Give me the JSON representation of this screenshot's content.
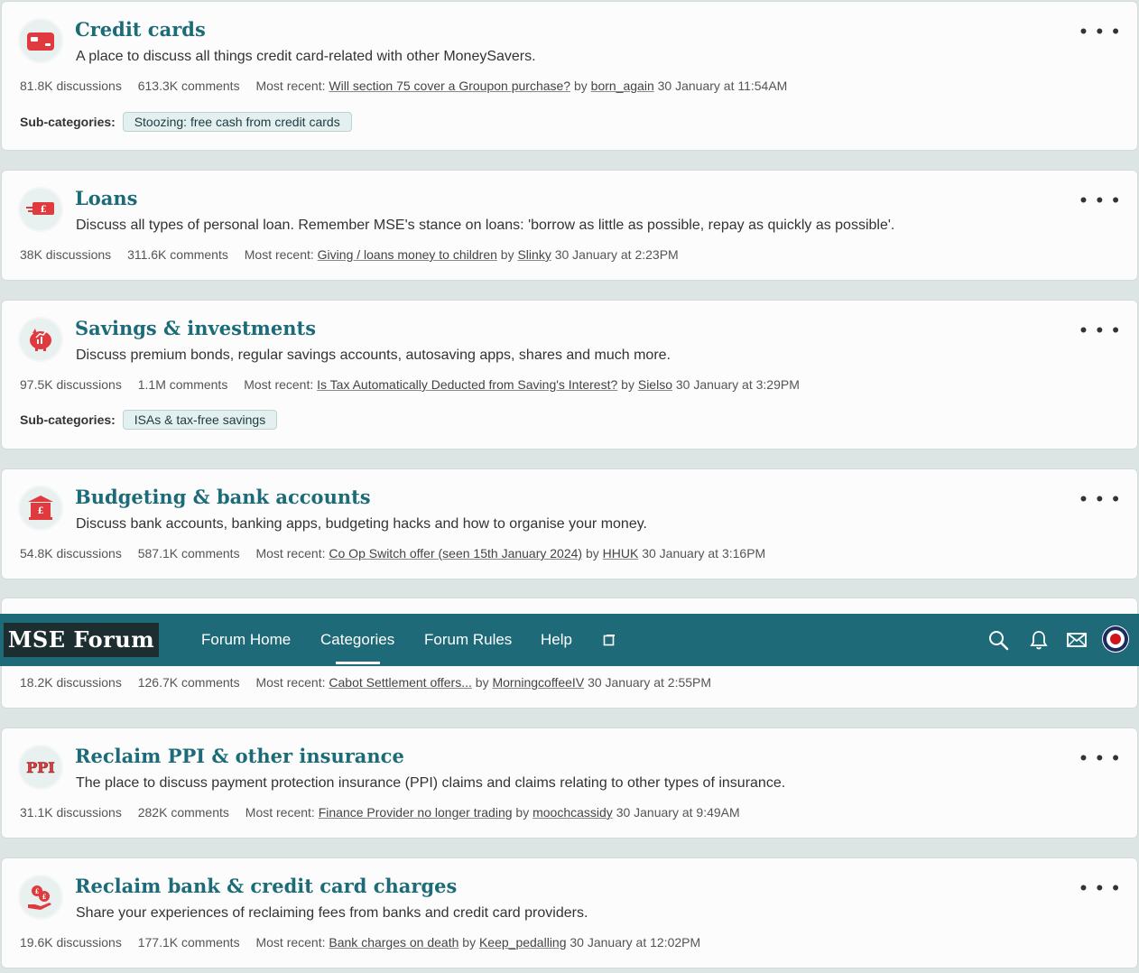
{
  "nav": {
    "logo": "MSE Forum",
    "items": [
      "Forum Home",
      "Categories",
      "Forum Rules",
      "Help"
    ],
    "active": "Categories"
  },
  "categories": [
    {
      "title": "Credit cards",
      "description": "A place to discuss all things credit card-related with other MoneySavers.",
      "discussions": "81.8K discussions",
      "comments": "613.3K comments",
      "most_recent_label": "Most recent:",
      "recent_title": "Will section 75 cover a Groupon purchase?",
      "by": "by",
      "author": "born_again",
      "date": "30 January at 11:54AM",
      "subcategories_label": "Sub-categories:",
      "subcategory": "Stoozing: free cash from credit cards"
    },
    {
      "title": "Loans",
      "description": "Discuss all types of personal loan. Remember MSE's stance on loans: 'borrow as little as possible, repay as quickly as possible'.",
      "discussions": "38K discussions",
      "comments": "311.6K comments",
      "most_recent_label": "Most recent:",
      "recent_title": "Giving / loans money to children",
      "by": "by",
      "author": "Slinky",
      "date": "30 January at 2:23PM"
    },
    {
      "title": "Savings & investments",
      "description": "Discuss premium bonds, regular savings accounts, autosaving apps, shares and much more.",
      "discussions": "97.5K discussions",
      "comments": "1.1M comments",
      "most_recent_label": "Most recent:",
      "recent_title": "Is Tax Automatically Deducted from Saving's Interest?",
      "by": "by",
      "author": "Sielso",
      "date": "30 January at 3:29PM",
      "subcategories_label": "Sub-categories:",
      "subcategory": "ISAs & tax-free savings"
    },
    {
      "title": "Budgeting & bank accounts",
      "description": "Discuss bank accounts, banking apps, budgeting hacks and how to organise your money.",
      "discussions": "54.8K discussions",
      "comments": "587.1K comments",
      "most_recent_label": "Most recent:",
      "recent_title": "Co Op Switch offer (seen 15th January 2024)",
      "by": "by",
      "author": "HHUK",
      "date": "30 January at 3:16PM"
    },
    {
      "discussions": "18.2K discussions",
      "comments": "126.7K comments",
      "most_recent_label": "Most recent:",
      "recent_title": "Cabot Settlement offers...",
      "by": "by",
      "author": "MorningcoffeeIV",
      "date": "30 January at 2:55PM"
    },
    {
      "title": "Reclaim PPI & other insurance",
      "icon_text": "PPI",
      "description": "The place to discuss payment protection insurance (PPI) claims and claims relating to other types of insurance.",
      "discussions": "31.1K discussions",
      "comments": "282K comments",
      "most_recent_label": "Most recent:",
      "recent_title": "Finance Provider no longer trading",
      "by": "by",
      "author": "moochcassidy",
      "date": "30 January at 9:49AM"
    },
    {
      "title": "Reclaim bank & credit card charges",
      "description": "Share your experiences of reclaiming fees from banks and credit card providers.",
      "discussions": "19.6K discussions",
      "comments": "177.1K comments",
      "most_recent_label": "Most recent:",
      "recent_title": "Bank charges on death",
      "by": "by",
      "author": "Keep_pedalling",
      "date": "30 January at 12:02PM"
    }
  ],
  "colors": {
    "accent": "#1b6b78",
    "navbar": "#1e6a79",
    "icon_red": "#e03a3e",
    "chip_bg": "#e3f0ef"
  },
  "icons": {
    "credit_card": "credit-card-icon",
    "loans": "loan-cash-icon",
    "savings": "piggy-bank-icon",
    "budgeting": "bank-building-icon",
    "ppi": "ppi-icon",
    "reclaim": "reclaim-coins-icon",
    "search": "search-icon",
    "bell": "bell-icon",
    "mail": "mail-icon",
    "external": "external-window-icon",
    "more": "more-options-icon"
  },
  "more_glyph": "• • •"
}
